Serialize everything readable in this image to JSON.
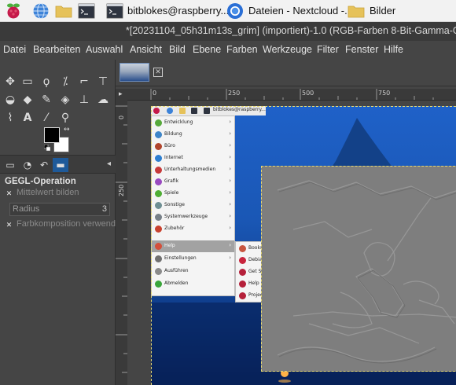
{
  "taskbar": {
    "terminal_task": "bitblokes@raspberry...",
    "browser_task": "Dateien - Nextcloud -...",
    "folder_task": "Bilder"
  },
  "window": {
    "title": "*[20231104_05h31m13s_grim] (importiert)-1.0 (RGB-Farben 8-Bit-Gamma-Ga"
  },
  "menubar": {
    "items": [
      "Datei",
      "Bearbeiten",
      "Auswahl",
      "Ansicht",
      "Bild",
      "Ebene",
      "Farben",
      "Werkzeuge",
      "Filter",
      "Fenster",
      "Hilfe"
    ]
  },
  "toolbox": {
    "gegl_title": "GEGL-Operation",
    "mean_label": "Mittelwert bilden",
    "radius_label": "Radius",
    "radius_value": "3",
    "blend_label": "Farbkomposition verwende"
  },
  "ruler": {
    "h_labels": [
      "0",
      "250",
      "500",
      "750"
    ],
    "v_labels": [
      "0",
      "250"
    ]
  },
  "inner": {
    "taskbar_text": "bitblokes@raspberry...",
    "menu_items": [
      {
        "label": "Entwicklung",
        "color": "#57a93b"
      },
      {
        "label": "Bildung",
        "color": "#3f86c8"
      },
      {
        "label": "Büro",
        "color": "#b1452c"
      },
      {
        "label": "Internet",
        "color": "#2d7fd0"
      },
      {
        "label": "Unterhaltungsmedien",
        "color": "#c73a3a"
      },
      {
        "label": "Grafik",
        "color": "#9a4ac0"
      },
      {
        "label": "Spiele",
        "color": "#4fae34"
      },
      {
        "label": "Sonstige",
        "color": "#6f8f93"
      },
      {
        "label": "Systemwerkzeuge",
        "color": "#778088"
      },
      {
        "label": "Zubehör",
        "color": "#c9422f"
      },
      {
        "label": "Help",
        "color": "#d44f3a"
      },
      {
        "label": "Einstellungen",
        "color": "#707070"
      },
      {
        "label": "Ausführen",
        "color": "#8a8a8a"
      },
      {
        "label": "Abmelden",
        "color": "#3aa53a"
      }
    ],
    "sub_items": [
      {
        "label": "Bookshelf",
        "color": "#c7553f"
      },
      {
        "label": "Debian Referenz",
        "color": "#c8243c"
      },
      {
        "label": "Get Started",
        "color": "#b5203a"
      },
      {
        "label": "Help",
        "color": "#b5203a"
      },
      {
        "label": "Projects",
        "color": "#b5203a"
      }
    ]
  }
}
